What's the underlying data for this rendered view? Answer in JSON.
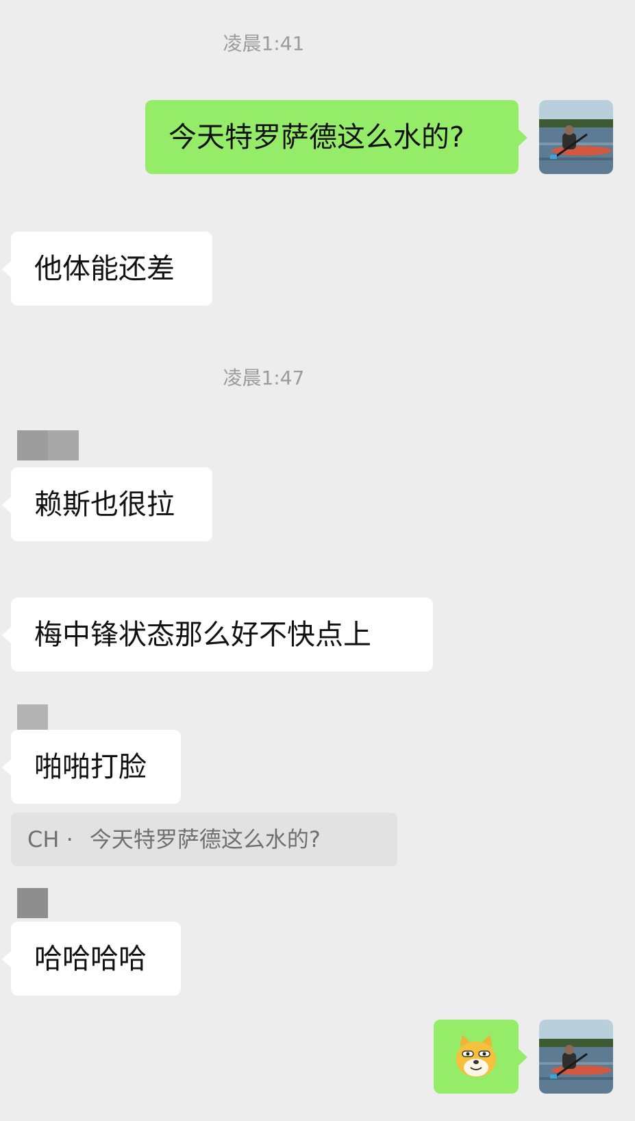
{
  "timestamps": [
    "凌晨1:41",
    "凌晨1:47"
  ],
  "messages": {
    "m1": "今天特罗萨德这么水的?",
    "m2": "他体能还差",
    "m3": "赖斯也很拉",
    "m4": "梅中锋状态那么好不快点上",
    "m5": "啪啪打脸",
    "m6": "哈哈哈哈"
  },
  "quote": {
    "author": "CH ·",
    "text": "今天特罗萨德这么水的?"
  },
  "colors": {
    "background": "#ededed",
    "outgoing_bubble": "#95ec69",
    "incoming_bubble": "#ffffff",
    "quote_background": "#e2e2e2"
  },
  "sticker": "doge-face-emoji"
}
